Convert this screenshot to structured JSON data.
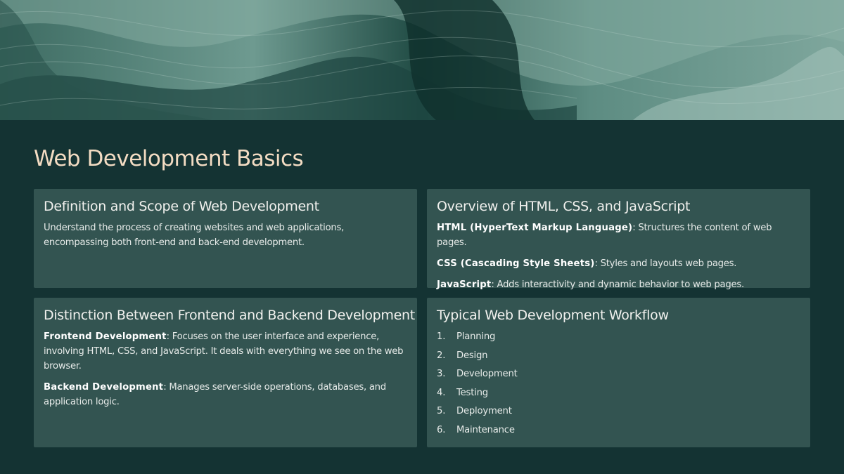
{
  "slide": {
    "title": "Web Development Basics",
    "banner_image": "green marbled abstract texture"
  },
  "cards": {
    "definition": {
      "heading": "Definition and Scope of Web Development",
      "text": "Understand the process of creating websites and web applications, encompassing both front-end and back-end development."
    },
    "overview": {
      "heading": "Overview of HTML, CSS, and JavaScript",
      "items": [
        {
          "term": "HTML (HyperText Markup Language)",
          "desc": ": Structures the content of web pages."
        },
        {
          "term": "CSS (Cascading Style Sheets)",
          "desc": ": Styles and layouts web pages."
        },
        {
          "term": "JavaScript",
          "desc": ": Adds interactivity and dynamic behavior to web pages."
        }
      ]
    },
    "distinction": {
      "heading": "Distinction Between Frontend and Backend Development",
      "items": [
        {
          "term": "Frontend Development",
          "desc": ": Focuses on the user interface and experience, involving HTML, CSS, and JavaScript. It deals with everything we see on the web browser."
        },
        {
          "term": "Backend Development",
          "desc": ": Manages server-side operations, databases, and application logic."
        }
      ]
    },
    "workflow": {
      "heading": "Typical Web Development Workflow",
      "steps": [
        {
          "num": "1.",
          "label": "Planning"
        },
        {
          "num": "2.",
          "label": "Design"
        },
        {
          "num": "3.",
          "label": "Development"
        },
        {
          "num": "4.",
          "label": "Testing"
        },
        {
          "num": "5.",
          "label": "Deployment"
        },
        {
          "num": "6.",
          "label": "Maintenance"
        }
      ]
    }
  },
  "colors": {
    "background": "#143333",
    "card": "#335451",
    "title": "#f3dcc3",
    "text": "#e7ebe9"
  }
}
